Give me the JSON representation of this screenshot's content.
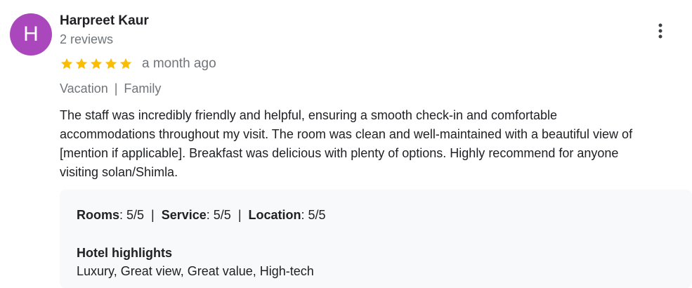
{
  "reviewer": {
    "initial": "H",
    "name": "Harpreet Kaur",
    "review_count": "2 reviews",
    "avatar_color": "#ab47bc"
  },
  "rating": {
    "stars": 5,
    "max_stars": 5,
    "star_color": "#fbbc04",
    "time_ago": "a month ago"
  },
  "trip": {
    "tags": [
      "Vacation",
      "Family"
    ],
    "separator": "|"
  },
  "review": {
    "lines": [
      "The staff was incredibly friendly and helpful, ensuring a smooth check-in and comfortable",
      "accommodations throughout my visit. The room was clean and well-maintained with a beautiful view of",
      "[mention if applicable]. Breakfast was delicious with plenty of options. Highly recommend for anyone",
      "visiting solan/Shimla."
    ]
  },
  "details": {
    "sub_ratings": [
      {
        "label": "Rooms",
        "value": ": 5/5"
      },
      {
        "label": "Service",
        "value": ": 5/5"
      },
      {
        "label": "Location",
        "value": ": 5/5"
      }
    ],
    "separator": "|",
    "highlights_title": "Hotel highlights",
    "highlights": "Luxury, Great view, Great value, High-tech"
  },
  "icons": {
    "more": "more-vert-icon",
    "star": "star-icon"
  }
}
